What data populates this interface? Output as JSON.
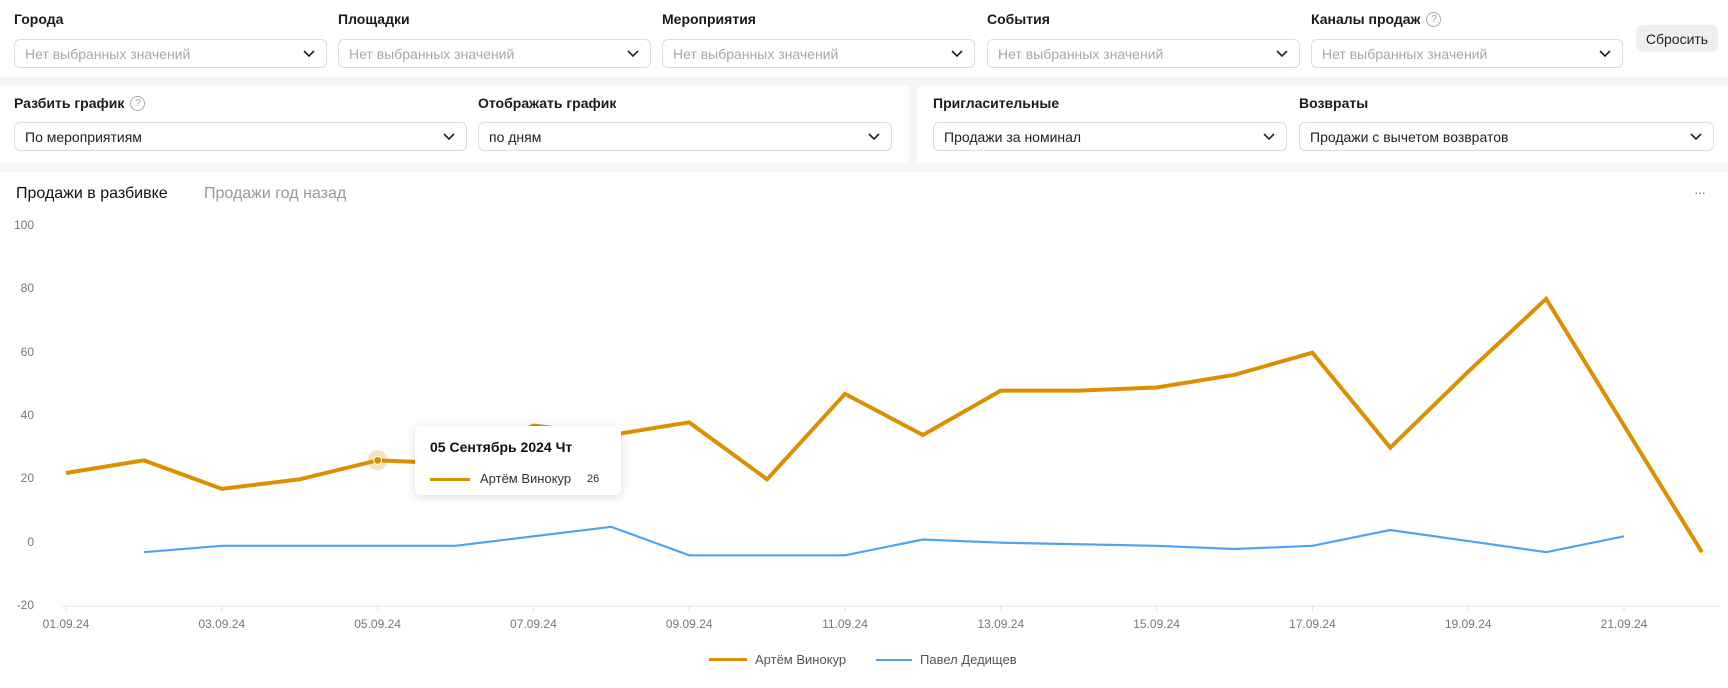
{
  "filters": [
    {
      "label": "Города",
      "placeholder": "Нет выбранных значений"
    },
    {
      "label": "Площадки",
      "placeholder": "Нет выбранных значений"
    },
    {
      "label": "Мероприятия",
      "placeholder": "Нет выбранных значений"
    },
    {
      "label": "События",
      "placeholder": "Нет выбранных значений"
    },
    {
      "label": "Каналы продаж",
      "placeholder": "Нет выбранных значений",
      "help": "?"
    }
  ],
  "reset_label": "Сбросить",
  "options": [
    {
      "label": "Разбить график",
      "value": "По мероприятиям",
      "help": "?"
    },
    {
      "label": "Отображать график",
      "value": "по дням"
    },
    {
      "label": "Пригласительные",
      "value": "Продажи за номинал"
    },
    {
      "label": "Возвраты",
      "value": "Продажи с вычетом возвратов"
    }
  ],
  "tabs": [
    {
      "label": "Продажи в разбивке",
      "active": true
    },
    {
      "label": "Продажи год назад",
      "active": false
    }
  ],
  "more_label": "···",
  "tooltip": {
    "title": "05 Сентябрь 2024 Чт",
    "series": "Артём Винокур",
    "value": "26"
  },
  "chart_data": {
    "type": "line",
    "x": [
      "01.09.24",
      "02.09.24",
      "03.09.24",
      "04.09.24",
      "05.09.24",
      "06.09.24",
      "07.09.24",
      "08.09.24",
      "09.09.24",
      "10.09.24",
      "11.09.24",
      "12.09.24",
      "13.09.24",
      "14.09.24",
      "15.09.24",
      "16.09.24",
      "17.09.24",
      "18.09.24",
      "19.09.24",
      "20.09.24",
      "21.09.24",
      "22.09.24"
    ],
    "xtick_labels": [
      "01.09.24",
      "03.09.24",
      "05.09.24",
      "07.09.24",
      "09.09.24",
      "11.09.24",
      "13.09.24",
      "15.09.24",
      "17.09.24",
      "19.09.24",
      "21.09.24"
    ],
    "yticks": [
      "100",
      "80",
      "60",
      "40",
      "20",
      "0",
      "-20"
    ],
    "ylim": [
      -20,
      100
    ],
    "legend_position": "bottom",
    "series": [
      {
        "name": "Артём Винокур",
        "color": "#dc9000",
        "values": [
          22,
          26,
          17,
          20,
          26,
          25,
          37,
          34,
          38,
          20,
          47,
          34,
          48,
          48,
          49,
          53,
          60,
          30,
          54,
          77,
          37,
          -3
        ]
      },
      {
        "name": "Павел Дедищев",
        "color": "#4ea4f2",
        "values": [
          null,
          -3,
          -1,
          -1,
          -1,
          -1,
          2,
          5,
          -4,
          -4,
          -4,
          1,
          0,
          -0.5,
          -1,
          -2,
          -1,
          4,
          0.5,
          -3,
          2,
          null
        ]
      }
    ],
    "highlight": {
      "index": 4,
      "series": 0
    }
  }
}
